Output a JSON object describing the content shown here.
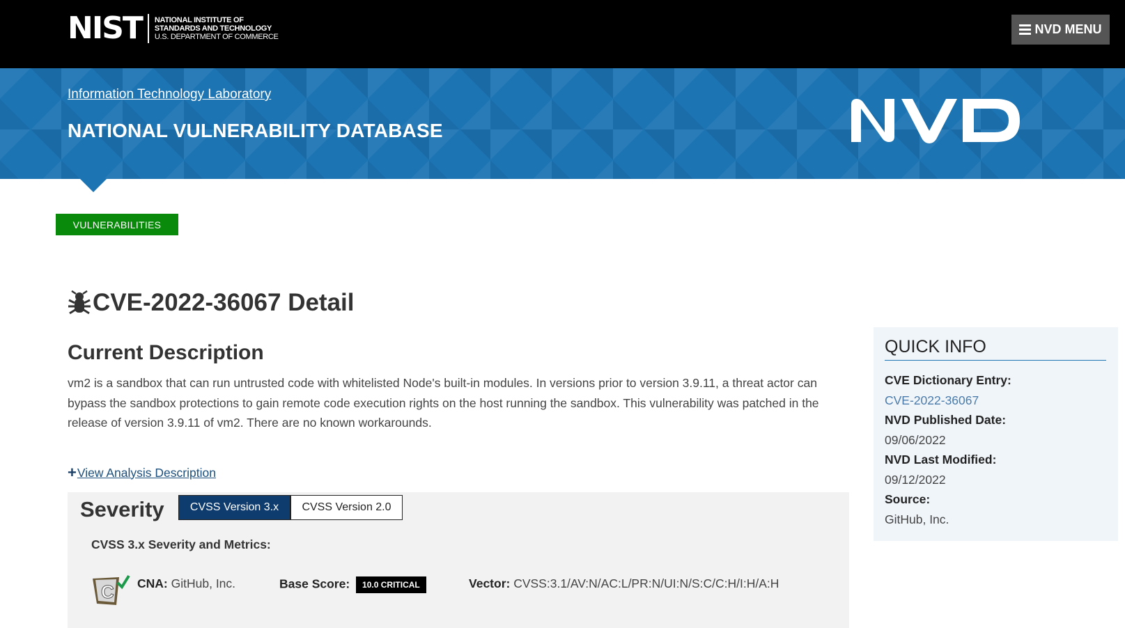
{
  "header": {
    "nist_mark": "NIST",
    "nist_line1": "NATIONAL INSTITUTE OF",
    "nist_line2": "STANDARDS AND TECHNOLOGY",
    "nist_line3": "U.S. DEPARTMENT OF COMMERCE",
    "menu_label": "NVD MENU"
  },
  "banner": {
    "itl_link": "Information Technology Laboratory",
    "title": "NATIONAL VULNERABILITY DATABASE",
    "logo_text": "NVD"
  },
  "badge": "VULNERABILITIES",
  "cve": {
    "title": "CVE-2022-36067 Detail",
    "description_heading": "Current Description",
    "description": "vm2 is a sandbox that can run untrusted code with whitelisted Node's built-in modules. In versions prior to version 3.9.11, a threat actor can bypass the sandbox protections to gain remote code execution rights on the host running the sandbox. This vulnerability was patched in the release of version 3.9.11 of vm2. There are no known workarounds.",
    "view_analysis": "View Analysis Description"
  },
  "severity": {
    "heading": "Severity",
    "tabs": [
      "CVSS Version 3.x",
      "CVSS Version 2.0"
    ],
    "metrics_heading": "CVSS 3.x Severity and Metrics:",
    "cna_label": "CNA:",
    "cna_value": "GitHub, Inc.",
    "base_label": "Base Score:",
    "base_value": "10.0 CRITICAL",
    "vector_label": "Vector:",
    "vector_value": "CVSS:3.1/AV:N/AC:L/PR:N/UI:N/S:C/C:H/I:H/A:H"
  },
  "quick_info": {
    "title": "QUICK INFO",
    "dict_label": "CVE Dictionary Entry:",
    "dict_value": "CVE-2022-36067",
    "published_label": "NVD Published Date:",
    "published_value": "09/06/2022",
    "modified_label": "NVD Last Modified:",
    "modified_value": "09/12/2022",
    "source_label": "Source:",
    "source_value": "GitHub, Inc."
  },
  "colors": {
    "banner_blue": "#1c74b3",
    "badge_green": "#0a8a0a",
    "tab_active": "#0f3c6e",
    "critical_badge": "#000000"
  },
  "icons": [
    "bug-icon",
    "hamburger-icon",
    "plus-icon",
    "cna-certificate-icon"
  ]
}
